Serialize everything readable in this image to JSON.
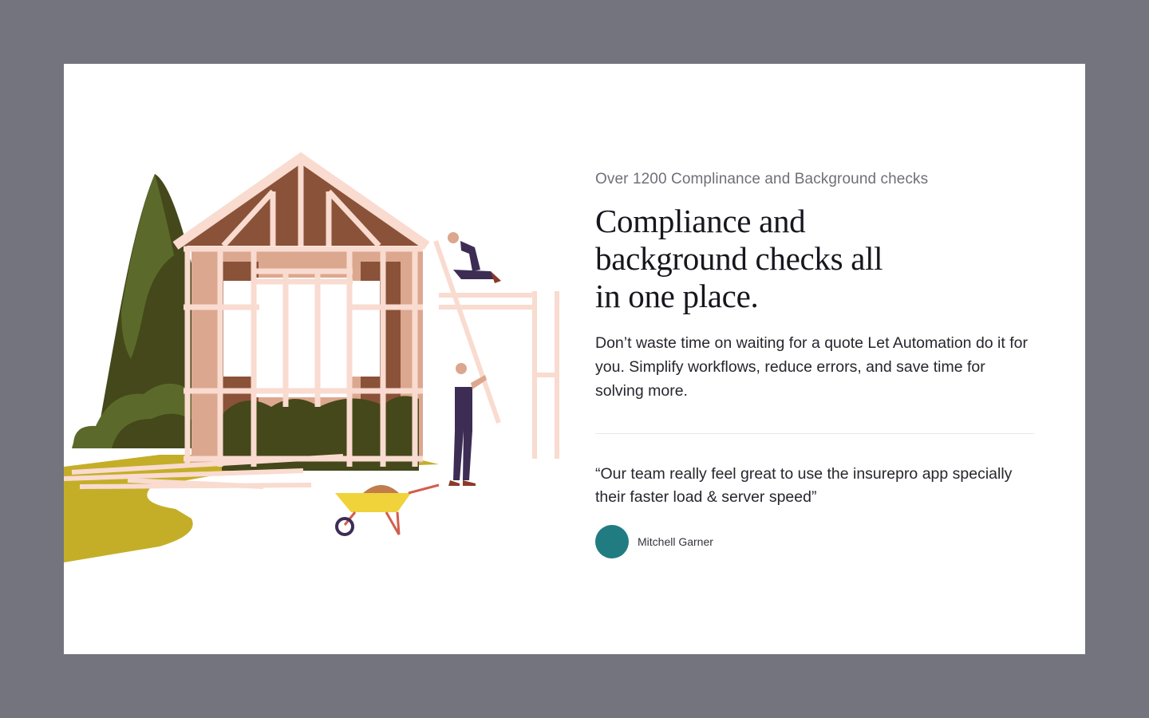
{
  "hero": {
    "eyebrow": "Over 1200 Complinance and Background checks",
    "headline_lines": [
      "Compliance and",
      "background checks all",
      "in one place."
    ],
    "description": "Don’t waste time on waiting for a quote Let Automation do it for you. Simplify workflows, reduce errors, and save time for solving more."
  },
  "testimonial": {
    "quote": "“Our team really feel great to use the insurepro app specially their faster load & server speed”",
    "author": "Mitchell Garner",
    "avatar_color": "#217c81"
  },
  "illustration": {
    "subject": "house-construction-illustration"
  }
}
